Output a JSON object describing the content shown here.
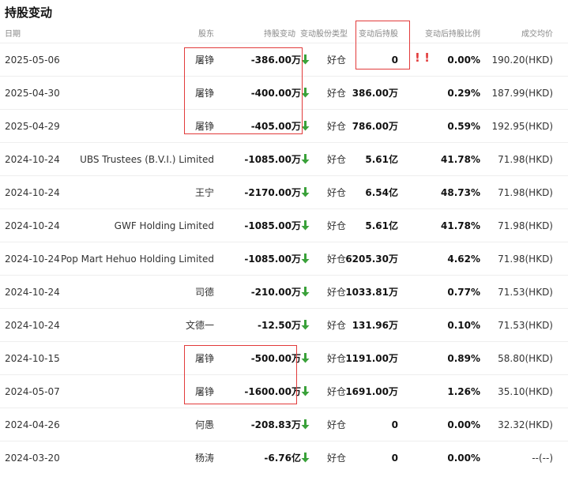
{
  "title": "持股变动",
  "columns": {
    "date": "日期",
    "holder": "股东",
    "change": "持股变动",
    "type": "变动股份类型",
    "after": "变动后持股",
    "ratio": "变动后持股比例",
    "price": "成交均价"
  },
  "colors": {
    "down_arrow": "#3aa13a",
    "highlight": "#e23b3b"
  },
  "annotation": "! !",
  "rows": [
    {
      "date": "2025-05-06",
      "holder": "屠铮",
      "change": "-386.00万",
      "type": "好仓",
      "after": "0",
      "ratio": "0.00%",
      "price": "190.20(HKD)"
    },
    {
      "date": "2025-04-30",
      "holder": "屠铮",
      "change": "-400.00万",
      "type": "好仓",
      "after": "386.00万",
      "ratio": "0.29%",
      "price": "187.99(HKD)"
    },
    {
      "date": "2025-04-29",
      "holder": "屠铮",
      "change": "-405.00万",
      "type": "好仓",
      "after": "786.00万",
      "ratio": "0.59%",
      "price": "192.95(HKD)"
    },
    {
      "date": "2024-10-24",
      "holder": "UBS Trustees (B.V.I.) Limited",
      "change": "-1085.00万",
      "type": "好仓",
      "after": "5.61亿",
      "ratio": "41.78%",
      "price": "71.98(HKD)"
    },
    {
      "date": "2024-10-24",
      "holder": "王宁",
      "change": "-2170.00万",
      "type": "好仓",
      "after": "6.54亿",
      "ratio": "48.73%",
      "price": "71.98(HKD)"
    },
    {
      "date": "2024-10-24",
      "holder": "GWF Holding Limited",
      "change": "-1085.00万",
      "type": "好仓",
      "after": "5.61亿",
      "ratio": "41.78%",
      "price": "71.98(HKD)"
    },
    {
      "date": "2024-10-24",
      "holder": "Pop Mart Hehuo Holding Limited",
      "change": "-1085.00万",
      "type": "好仓",
      "after": "6205.30万",
      "ratio": "4.62%",
      "price": "71.98(HKD)"
    },
    {
      "date": "2024-10-24",
      "holder": "司德",
      "change": "-210.00万",
      "type": "好仓",
      "after": "1033.81万",
      "ratio": "0.77%",
      "price": "71.53(HKD)"
    },
    {
      "date": "2024-10-24",
      "holder": "文德一",
      "change": "-12.50万",
      "type": "好仓",
      "after": "131.96万",
      "ratio": "0.10%",
      "price": "71.53(HKD)"
    },
    {
      "date": "2024-10-15",
      "holder": "屠铮",
      "change": "-500.00万",
      "type": "好仓",
      "after": "1191.00万",
      "ratio": "0.89%",
      "price": "58.80(HKD)"
    },
    {
      "date": "2024-05-07",
      "holder": "屠铮",
      "change": "-1600.00万",
      "type": "好仓",
      "after": "1691.00万",
      "ratio": "1.26%",
      "price": "35.10(HKD)"
    },
    {
      "date": "2024-04-26",
      "holder": "何愚",
      "change": "-208.83万",
      "type": "好仓",
      "after": "0",
      "ratio": "0.00%",
      "price": "32.32(HKD)"
    },
    {
      "date": "2024-03-20",
      "holder": "杨涛",
      "change": "-6.76亿",
      "type": "好仓",
      "after": "0",
      "ratio": "0.00%",
      "price": "--(--)"
    }
  ]
}
